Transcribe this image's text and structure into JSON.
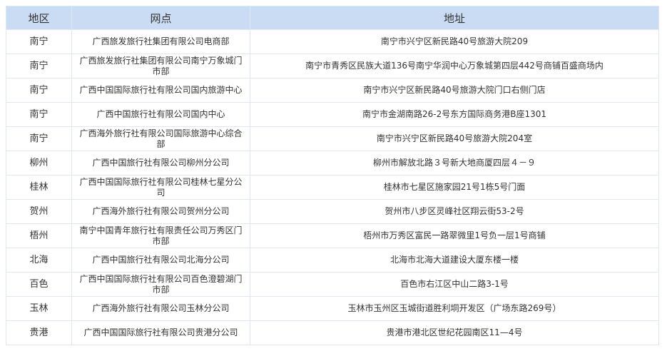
{
  "table": {
    "headers": [
      "地区",
      "网点",
      "地址"
    ],
    "rows": [
      {
        "region": "南宁",
        "branch": "广西旅发旅行社集团有限公司电商部",
        "address": "南宁市兴宁区新民路40号旅游大院209"
      },
      {
        "region": "南宁",
        "branch": "广西旅发旅行社集团有限公司南宁万象城门市部",
        "address": "南宁市青秀区民族大道136号南宁华润中心万象城第四层442号商铺百盛商场内"
      },
      {
        "region": "南宁",
        "branch": "广西中国国际旅行社有限公司国内旅游中心",
        "address": "南宁市兴宁区新民路40号旅游大院门口右侧门店"
      },
      {
        "region": "南宁",
        "branch": "广西中国旅行社有限公司国内中心",
        "address": "南宁市金湖南路26-2号东方国际商务港B座1301"
      },
      {
        "region": "南宁",
        "branch": "广西海外旅行社有限公司国际旅游中心综合部",
        "address": "南宁市兴宁区新民路40号旅游大院204室"
      },
      {
        "region": "柳州",
        "branch": "广西中国旅行社有限公司柳州分公司",
        "address": "柳州市解放北路３号新大地商厦四层４－９"
      },
      {
        "region": "桂林",
        "branch": "广西中国国际旅行社有限公司桂林七星分公司",
        "address": "桂林市七星区施家园21号1栋5号门面"
      },
      {
        "region": "贺州",
        "branch": "广西海外旅行社有限公司贺州分公司",
        "address": "贺州市八步区灵峰社区翔云街53-2号"
      },
      {
        "region": "梧州",
        "branch": "南宁中国青年旅行社有限责任公司万秀区门市部",
        "address": "梧州市万秀区富民一路翠微里1号负一层1号商铺"
      },
      {
        "region": "北海",
        "branch": "广西中国旅行社有限公司北海分公司",
        "address": "北海市北海大道建设大厦东楼一楼"
      },
      {
        "region": "百色",
        "branch": "广西中国国际旅行社有限公司百色澄碧湖门市部",
        "address": "百色市右江区中山二路3-1号"
      },
      {
        "region": "玉林",
        "branch": "广西海外旅行社有限公司玉林分公司",
        "address": "玉林市玉州区玉城街道胜利垌开发区（广场东路269号）"
      },
      {
        "region": "贵港",
        "branch": "广西中国国际旅行社有限公司贵港分公司",
        "address": "贵港市港北区世纪花园南区11—4号"
      }
    ]
  }
}
